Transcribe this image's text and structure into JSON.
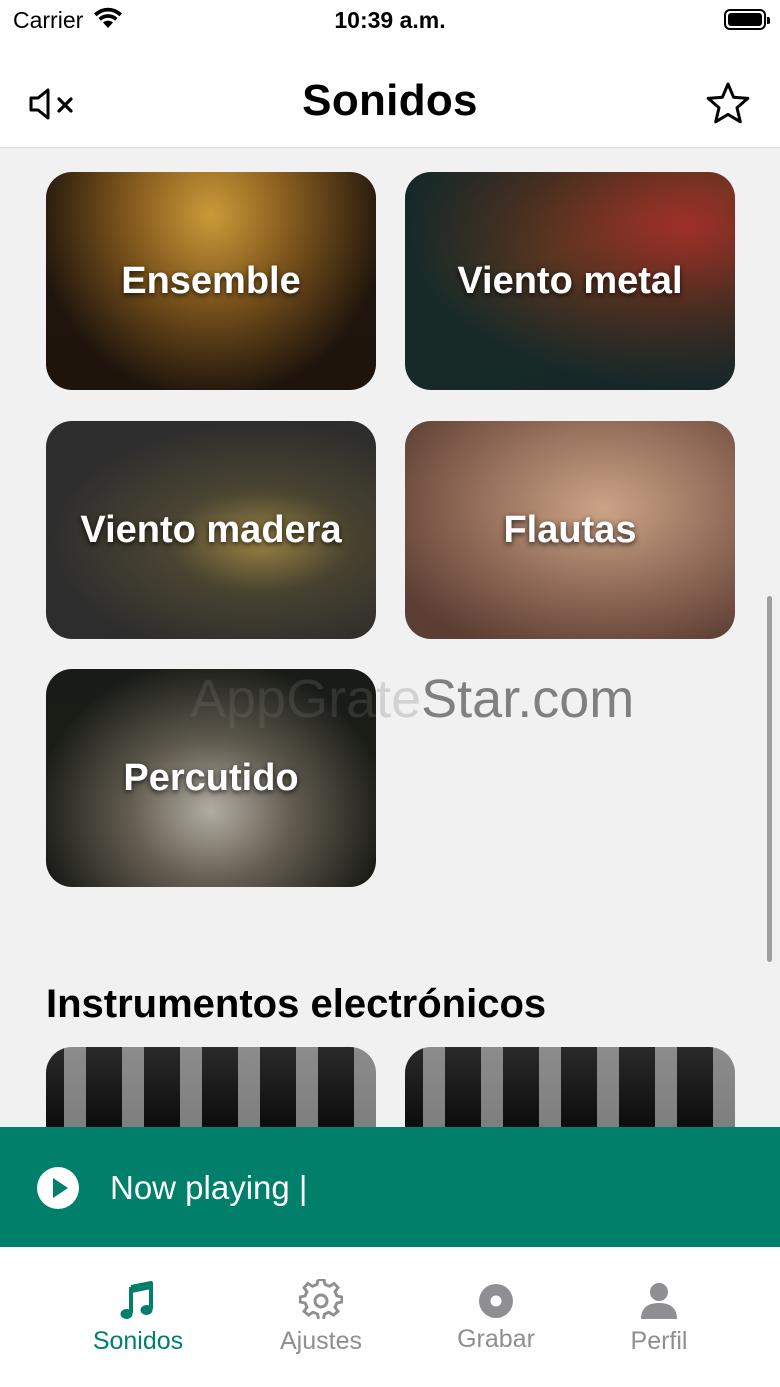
{
  "status_bar": {
    "carrier": "Carrier",
    "time": "10:39 a.m."
  },
  "header": {
    "title": "Sonidos",
    "mute_icon": "speaker-muted-icon",
    "favorite_icon": "star-icon"
  },
  "categories": [
    {
      "label": "Ensemble"
    },
    {
      "label": "Viento metal"
    },
    {
      "label": "Viento madera"
    },
    {
      "label": "Flautas"
    },
    {
      "label": "Percutido"
    }
  ],
  "watermark": {
    "faded": "AppGrate",
    "strong": "Star.com"
  },
  "electronic_section": {
    "title": "Instrumentos electrónicos"
  },
  "now_playing": {
    "text": "Now playing |",
    "icon": "play-circle-icon"
  },
  "tabs": [
    {
      "label": "Sonidos",
      "icon": "music-note-icon",
      "active": true
    },
    {
      "label": "Ajustes",
      "icon": "gear-icon",
      "active": false
    },
    {
      "label": "Grabar",
      "icon": "record-icon",
      "active": false
    },
    {
      "label": "Perfil",
      "icon": "person-icon",
      "active": false
    }
  ],
  "colors": {
    "accent": "#00806a",
    "inactive_tab": "#8e8e93",
    "background": "#f1f1f1"
  }
}
